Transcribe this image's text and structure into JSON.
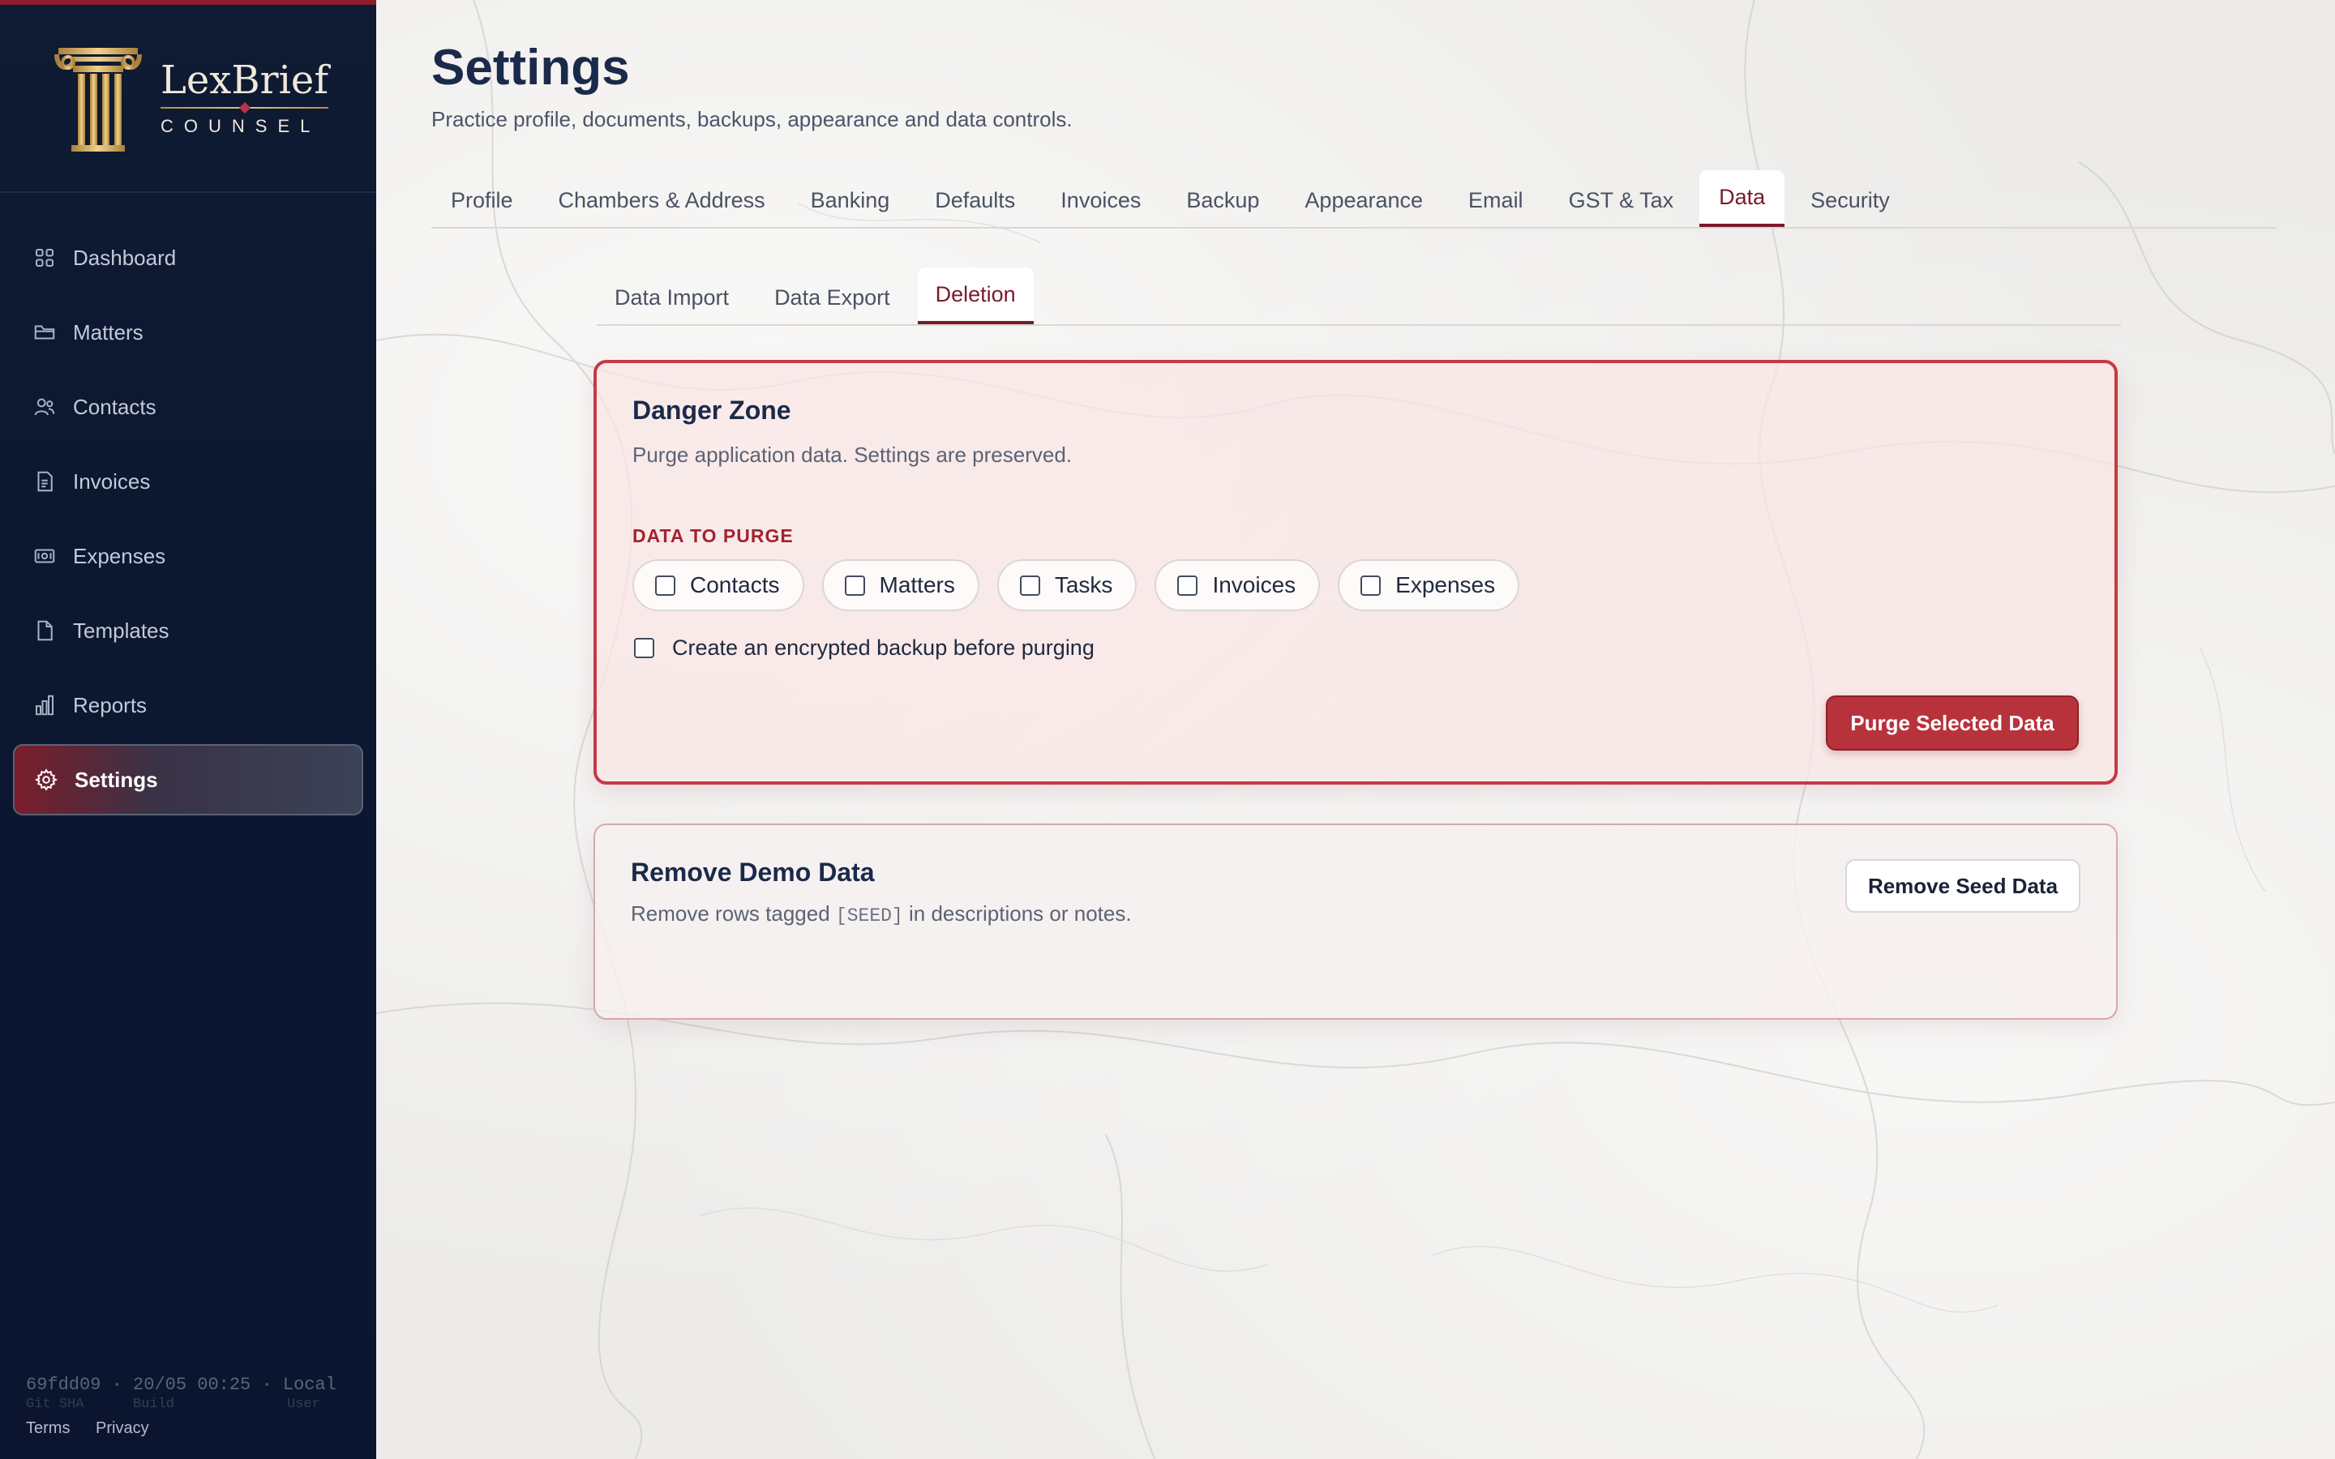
{
  "brand": {
    "name": "LexBrief",
    "sub": "COUNSEL"
  },
  "nav": {
    "items": [
      {
        "label": "Dashboard",
        "icon": "grid-icon"
      },
      {
        "label": "Matters",
        "icon": "folder-icon"
      },
      {
        "label": "Contacts",
        "icon": "users-icon"
      },
      {
        "label": "Invoices",
        "icon": "invoice-icon"
      },
      {
        "label": "Expenses",
        "icon": "banknote-icon"
      },
      {
        "label": "Templates",
        "icon": "file-icon"
      },
      {
        "label": "Reports",
        "icon": "bar-chart-icon"
      },
      {
        "label": "Settings",
        "icon": "gear-icon"
      }
    ],
    "active": "Settings"
  },
  "build": {
    "sha": "69fdd09",
    "time": "20/05 00:25",
    "env": "Local",
    "sha_caption": "Git SHA",
    "time_caption": "Build",
    "env_caption": "User",
    "sep": "·"
  },
  "legal": {
    "terms": "Terms",
    "privacy": "Privacy"
  },
  "page": {
    "title": "Settings",
    "subtitle": "Practice profile, documents, backups, appearance and data controls."
  },
  "tabs": [
    "Profile",
    "Chambers & Address",
    "Banking",
    "Defaults",
    "Invoices",
    "Backup",
    "Appearance",
    "Email",
    "GST & Tax",
    "Data",
    "Security"
  ],
  "active_tab": "Data",
  "subtabs": [
    "Data Import",
    "Data Export",
    "Deletion"
  ],
  "active_subtab": "Deletion",
  "danger": {
    "title": "Danger Zone",
    "description": "Purge application data. Settings are preserved.",
    "purge_label": "DATA TO PURGE",
    "options": [
      "Contacts",
      "Matters",
      "Tasks",
      "Invoices",
      "Expenses"
    ],
    "backup_label": "Create an encrypted backup before purging",
    "purge_button": "Purge Selected Data"
  },
  "demo": {
    "title": "Remove Demo Data",
    "desc_before": "Remove rows tagged",
    "desc_code": "[SEED]",
    "desc_after": "in descriptions or notes.",
    "button": "Remove Seed Data"
  },
  "colors": {
    "sidebar": "#0f1a33",
    "accent": "#7a1a2a",
    "danger": "#b8323c",
    "gold": "#c9a24f"
  }
}
